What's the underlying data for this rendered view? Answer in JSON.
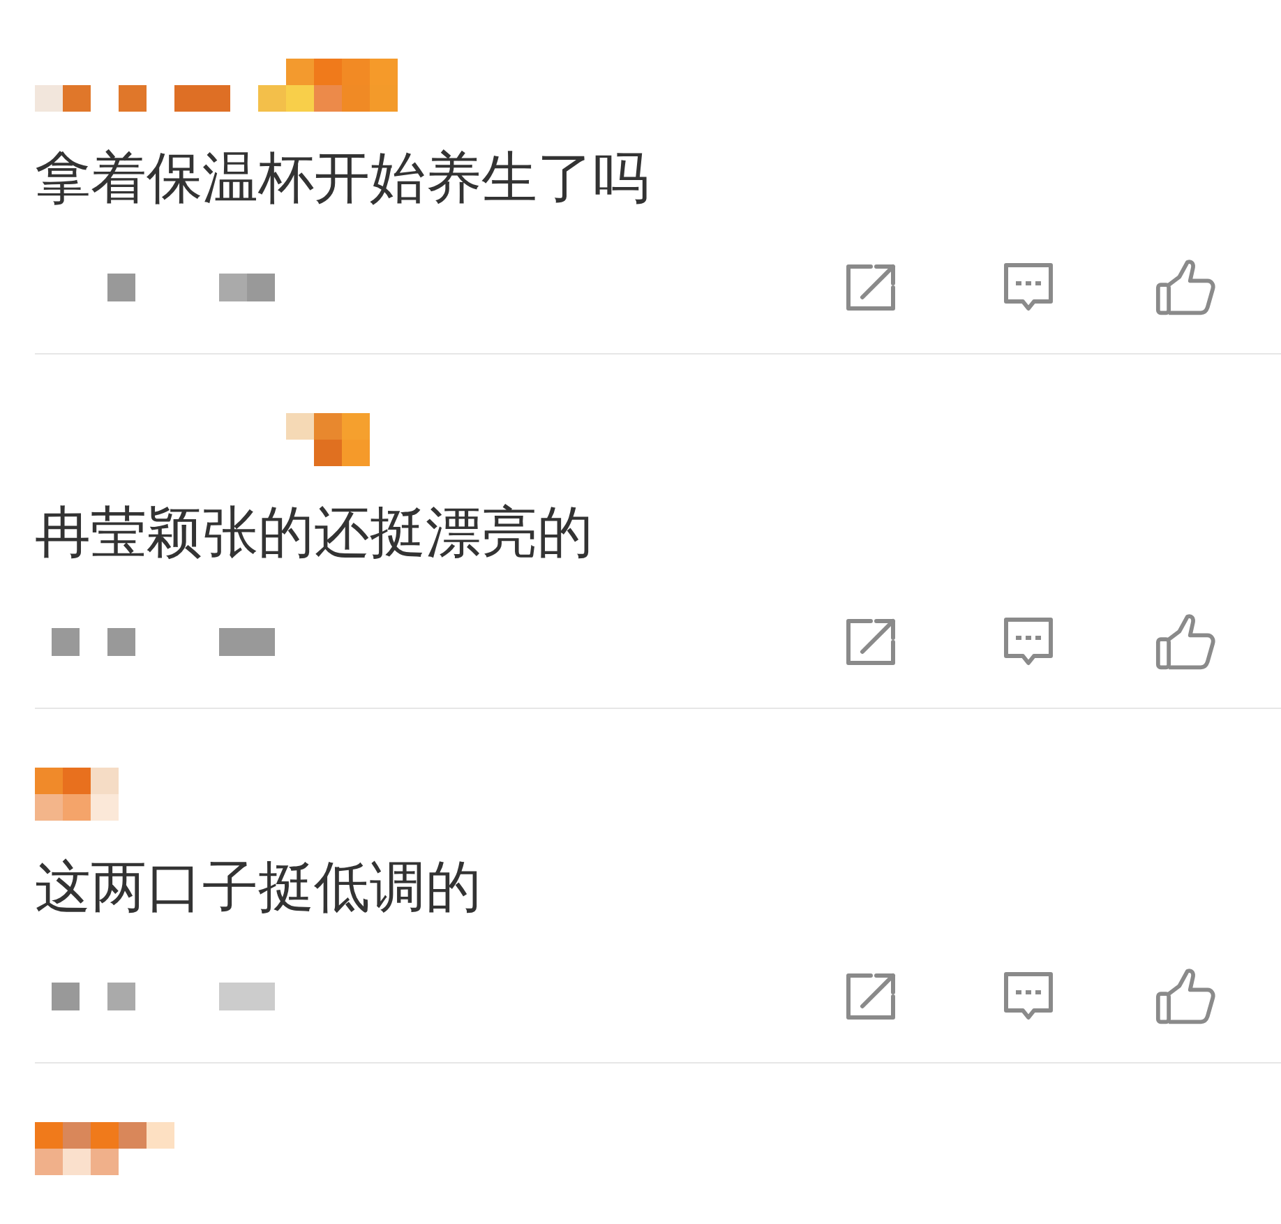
{
  "comments": [
    {
      "kind": "full",
      "text": "拿着保温杯开始养生了吗"
    },
    {
      "kind": "full",
      "text": "冉莹颖张的还挺漂亮的"
    },
    {
      "kind": "full",
      "text": "这两口子挺低调的"
    },
    {
      "kind": "partial"
    }
  ]
}
